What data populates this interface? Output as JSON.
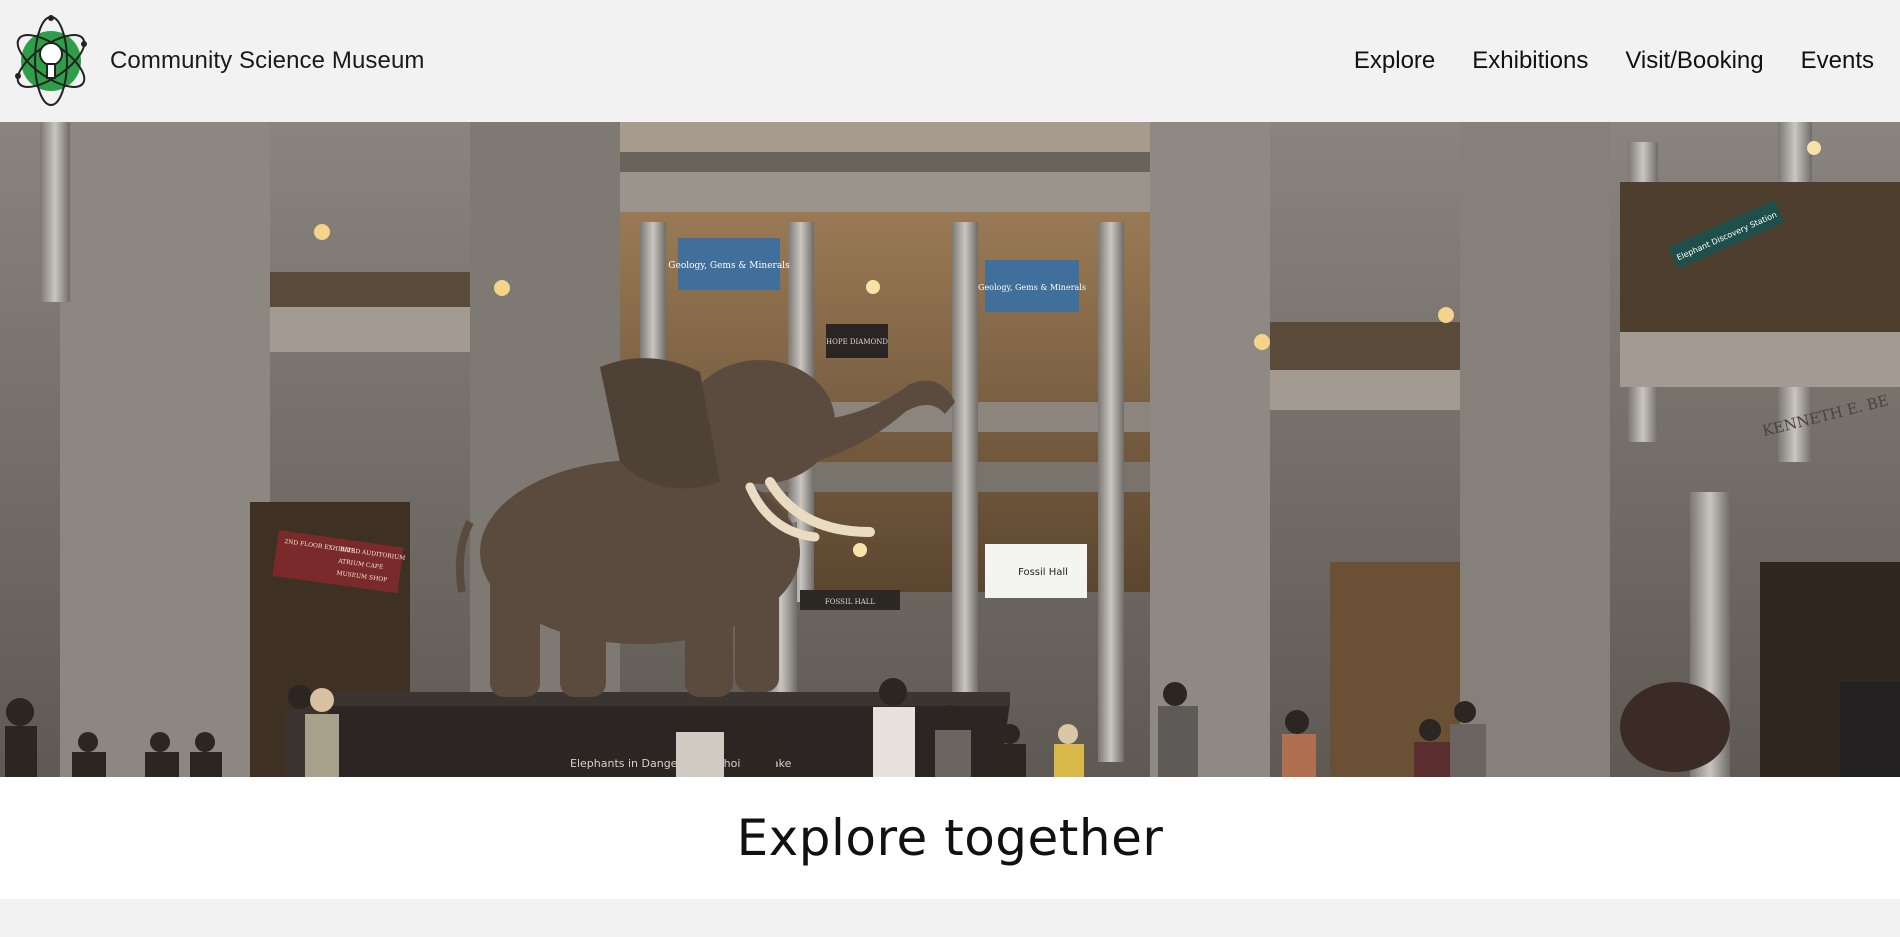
{
  "header": {
    "site_name": "Community Science Museum",
    "logo_icon": "atom-lightbulb-icon",
    "nav": [
      {
        "label": "Explore"
      },
      {
        "label": "Exhibitions"
      },
      {
        "label": "Visit/Booking"
      },
      {
        "label": "Events"
      }
    ]
  },
  "hero": {
    "signs": {
      "geology_left": "Geology, Gems & Minerals",
      "geology_right": "Geology, Gems & Minerals",
      "hope_diamond": "HOPE DIAMOND",
      "fossil_hall": "Fossil Hall",
      "fossil_hall_door": "FOSSIL HALL",
      "elephant_station": "Elephant Discovery Station",
      "kenneth": "KENNETH E. BE",
      "directory_1": "2ND FLOOR EXHIBITS",
      "directory_2": "BAIRD AUDITORIUM",
      "directory_3": "ATRIUM CAFE",
      "directory_4": "MUSEUM SHOP",
      "plinth": "Elephants in Danger: Your Choices Make"
    }
  },
  "main": {
    "headline": "Explore together"
  },
  "colors": {
    "header_bg": "#f2f2f2",
    "logo_green": "#2e9e48",
    "text": "#111111"
  }
}
